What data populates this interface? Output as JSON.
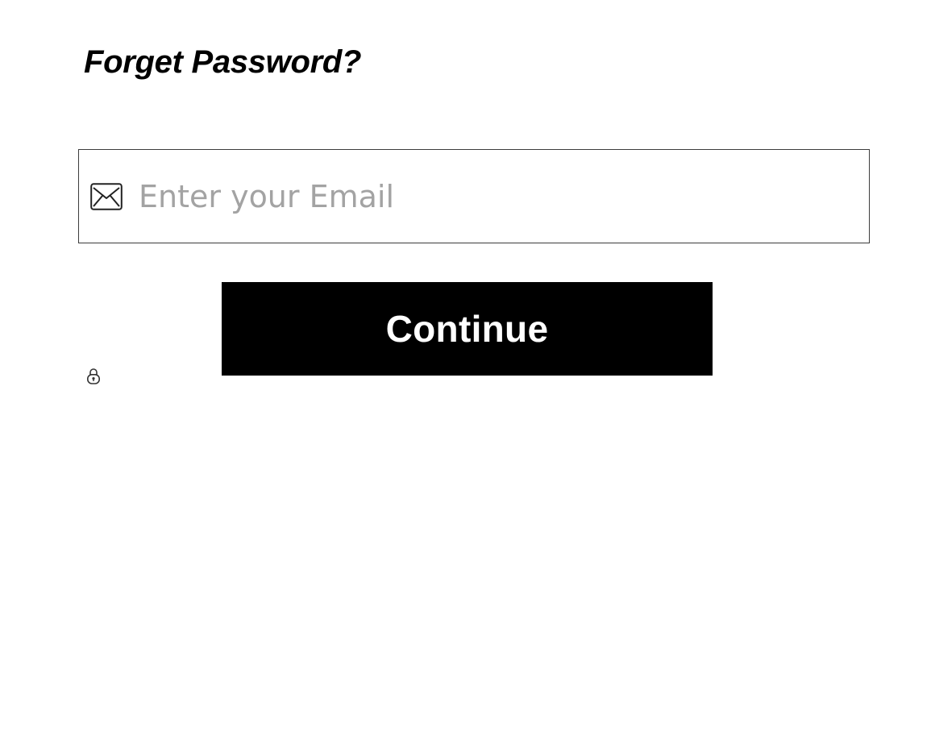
{
  "form": {
    "title": "Forget Password?",
    "email": {
      "placeholder": "Enter your Email",
      "value": "",
      "icon": "mail-icon"
    },
    "continue_label": "Continue",
    "lock_icon": "lock-icon"
  },
  "colors": {
    "background": "#ffffff",
    "button_bg": "#000000",
    "button_text": "#ffffff",
    "placeholder": "#a3a3a3",
    "border": "#3c3c3c"
  }
}
